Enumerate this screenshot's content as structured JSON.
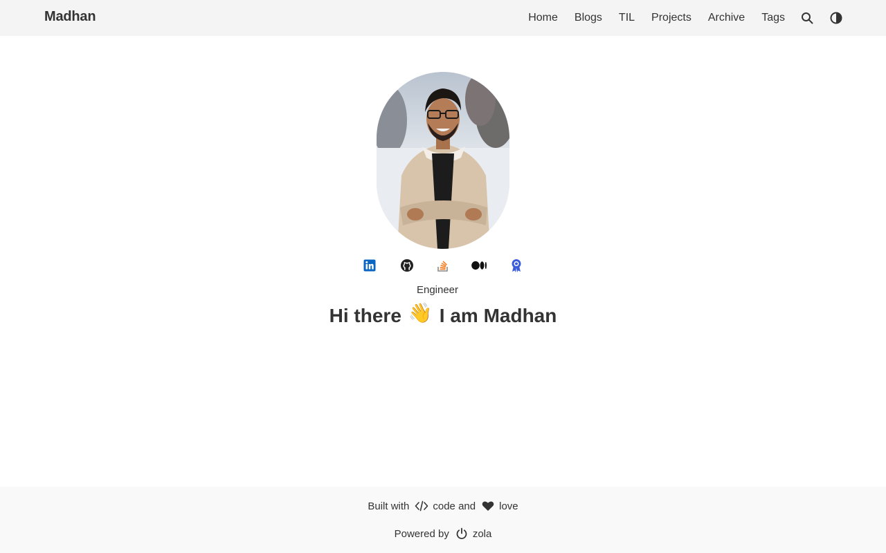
{
  "header": {
    "brand": "Madhan",
    "nav": [
      {
        "label": "Home"
      },
      {
        "label": "Blogs"
      },
      {
        "label": "TIL"
      },
      {
        "label": "Projects"
      },
      {
        "label": "Archive"
      },
      {
        "label": "Tags"
      }
    ],
    "icons": [
      "search-icon",
      "theme-toggle-icon"
    ]
  },
  "profile": {
    "socials": [
      "linkedin-icon",
      "github-icon",
      "stackoverflow-icon",
      "medium-icon",
      "certification-icon"
    ],
    "role": "Engineer",
    "greeting": "Hi there",
    "greeting_emoji": "👋",
    "intro": "I am Madhan"
  },
  "footer": {
    "built_prefix": "Built with",
    "built_code": "code and",
    "built_love": "love",
    "powered_prefix": "Powered by",
    "powered_by": "zola"
  },
  "colors": {
    "header_bg": "#f4f4f4",
    "footer_bg": "#f9f9f9",
    "text": "#333333",
    "linkedin": "#0a66c2",
    "stackoverflow": "#f48024",
    "certification": "#3b5bdb"
  }
}
